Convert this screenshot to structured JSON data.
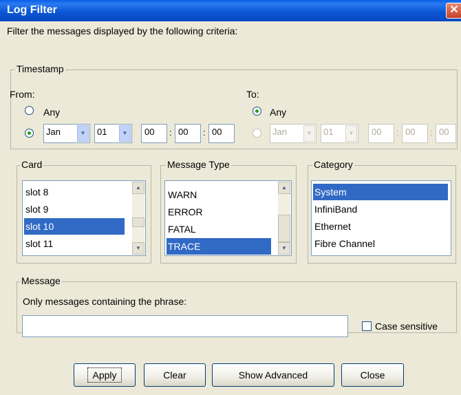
{
  "window": {
    "title": "Log Filter",
    "close_glyph": "✕"
  },
  "intro": "Filter the messages displayed by the following criteria:",
  "timestamp": {
    "legend": "Timestamp",
    "from": {
      "label": "From:",
      "any_label": "Any",
      "month": "Jan",
      "day": "01",
      "hour": "00",
      "minute": "00",
      "second": "00",
      "selected": "date"
    },
    "to": {
      "label": "To:",
      "any_label": "Any",
      "month": "Jan",
      "day": "01",
      "hour": "00",
      "minute": "00",
      "second": "00",
      "selected": "any"
    },
    "sep": ":"
  },
  "card": {
    "legend": "Card",
    "items": [
      "slot 8",
      "slot 9",
      "slot 10",
      "slot 11"
    ],
    "selected": "slot 10"
  },
  "message_type": {
    "legend": "Message Type",
    "items": [
      "WARN",
      "ERROR",
      "FATAL",
      "TRACE"
    ],
    "selected": "TRACE"
  },
  "category": {
    "legend": "Category",
    "items": [
      "System",
      "InfiniBand",
      "Ethernet",
      "Fibre Channel"
    ],
    "selected": "System"
  },
  "message": {
    "legend": "Message",
    "prompt": "Only messages containing the phrase:",
    "phrase": "",
    "case_sensitive_label": "Case sensitive",
    "case_sensitive": false
  },
  "buttons": {
    "apply": "Apply",
    "clear": "Clear",
    "show_advanced": "Show Advanced",
    "close": "Close"
  },
  "colors": {
    "title_bar": "#0b57d6",
    "selection": "#316ac5",
    "dialog_bg": "#ece9d8"
  }
}
